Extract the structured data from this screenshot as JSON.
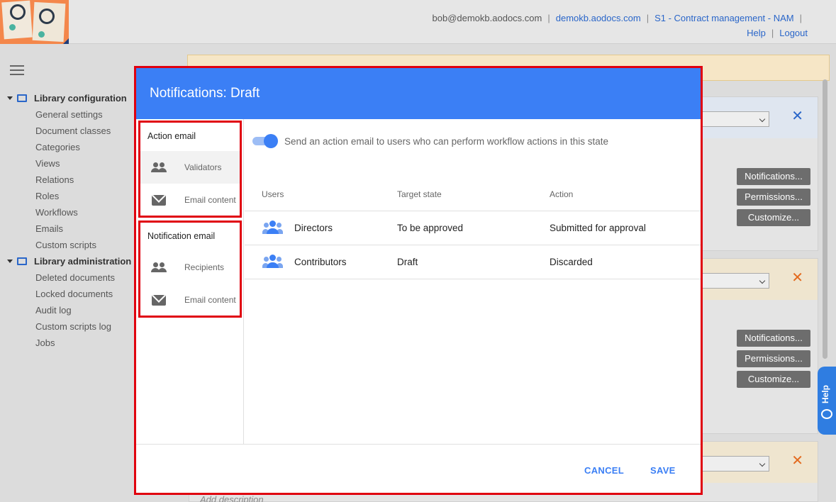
{
  "header": {
    "user_email": "bob@demokb.aodocs.com",
    "domain": "demokb.aodocs.com",
    "library": "S1 - Contract management - NAM",
    "help": "Help",
    "logout": "Logout"
  },
  "sidebar": {
    "groups": [
      {
        "label": "Library configuration",
        "items": [
          "General settings",
          "Document classes",
          "Categories",
          "Views",
          "Relations",
          "Roles",
          "Workflows",
          "Emails",
          "Custom scripts"
        ]
      },
      {
        "label": "Library administration",
        "items": [
          "Deleted documents",
          "Locked documents",
          "Audit log",
          "Custom scripts log",
          "Jobs"
        ]
      }
    ]
  },
  "background": {
    "panel_buttons": [
      "Notifications...",
      "Permissions...",
      "Customize..."
    ],
    "help_tab": "Help",
    "add_description": "Add description"
  },
  "dialog": {
    "title": "Notifications: Draft",
    "sections": [
      {
        "title": "Action email",
        "items": [
          {
            "label": "Validators",
            "icon": "people-icon",
            "active": true
          },
          {
            "label": "Email content",
            "icon": "mail-icon",
            "active": false
          }
        ]
      },
      {
        "title": "Notification email",
        "items": [
          {
            "label": "Recipients",
            "icon": "people-icon",
            "active": false
          },
          {
            "label": "Email content",
            "icon": "mail-icon",
            "active": false
          }
        ]
      }
    ],
    "toggle_label": "Send an action email to users who can perform workflow actions in this state",
    "toggle_on": true,
    "table": {
      "columns": [
        "Users",
        "Target state",
        "Action"
      ],
      "rows": [
        {
          "user": "Directors",
          "target_state": "To be approved",
          "action": "Submitted for approval"
        },
        {
          "user": "Contributors",
          "target_state": "Draft",
          "action": "Discarded"
        }
      ]
    },
    "cancel_label": "CANCEL",
    "save_label": "SAVE"
  },
  "colors": {
    "accent": "#3b7ff5",
    "highlight_border": "#e0000f"
  }
}
